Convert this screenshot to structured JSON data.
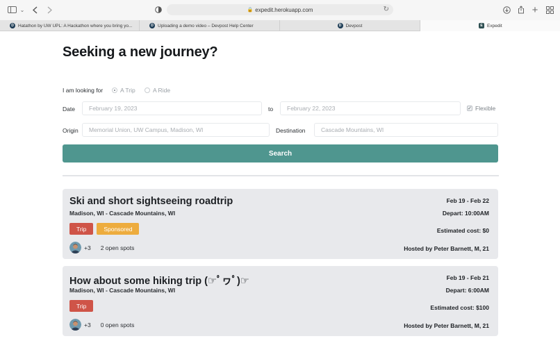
{
  "browser": {
    "url": "expedit.herokuapp.com",
    "tabs": [
      {
        "label": "Hatathon by UW UPL: A Hackathon where you bring yo...",
        "favicon": "D"
      },
      {
        "label": "Uploading a demo video – Devpost Help Center",
        "favicon": "D"
      },
      {
        "label": "Devpost",
        "favicon": "D"
      },
      {
        "label": "",
        "favicon": ""
      },
      {
        "label": "Expedit",
        "favicon": "E"
      }
    ]
  },
  "page": {
    "title": "Seeking a new journey?"
  },
  "form": {
    "looking_for_label": "I am looking for",
    "option_trip": "A Trip",
    "option_ride": "A Ride",
    "selected": "A Trip",
    "date_label": "Date",
    "date_from_placeholder": "February 19, 2023",
    "to_label": "to",
    "date_to_placeholder": "February 22, 2023",
    "flexible_label": "Flexible",
    "flexible_checked": true,
    "origin_label": "Origin",
    "origin_placeholder": "Memorial Union, UW Campus, Madison, WI",
    "destination_label": "Destination",
    "destination_placeholder": "Cascade Mountains, WI",
    "search_label": "Search"
  },
  "trips": [
    {
      "title": "Ski and short sightseeing roadtrip",
      "route": "Madison, WI - Cascade Mountains, WI",
      "tags": [
        "Trip",
        "Sponsored"
      ],
      "extra_people": "+3",
      "open_spots": "2 open spots",
      "dates": "Feb 19 - Feb 22",
      "depart": "Depart: 10:00AM",
      "cost": "Estimated cost: $0",
      "host": "Hosted by Peter Barnett, M, 21"
    },
    {
      "title": "How about some hiking trip (☞ﾟヮﾟ)☞",
      "route": "Madison, WI - Cascade Mountains, WI",
      "tags": [
        "Trip"
      ],
      "extra_people": "+3",
      "open_spots": "0 open spots",
      "dates": "Feb 19 - Feb 21",
      "depart": "Depart: 6:00AM",
      "cost": "Estimated cost: $100",
      "host": "Hosted by Peter Barnett, M, 21"
    }
  ],
  "colors": {
    "accent": "#4f968f",
    "trip_tag": "#cf5448",
    "sponsored_tag": "#edac3e",
    "card_bg": "#e8e9ec"
  }
}
